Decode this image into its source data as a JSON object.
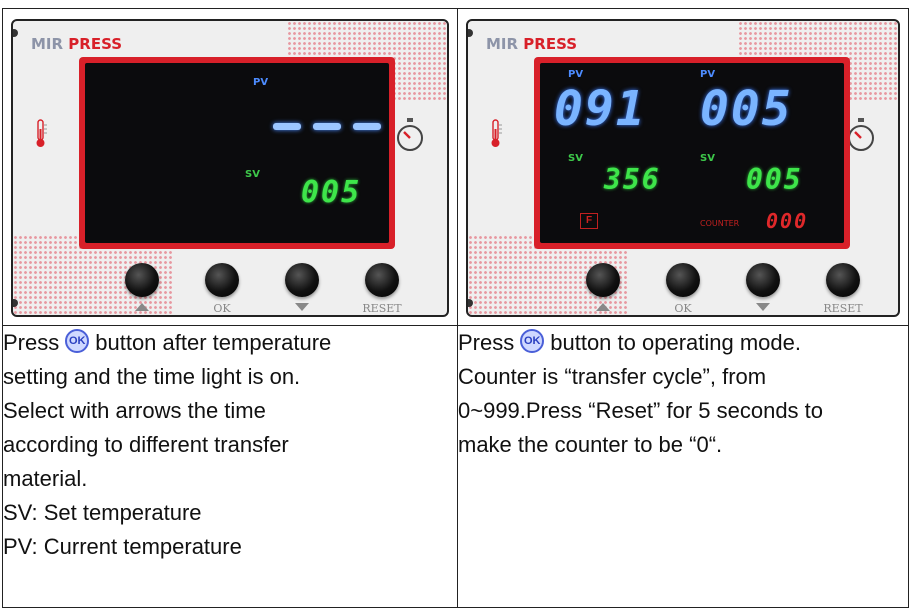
{
  "left_panel": {
    "brand_mir": "MIR",
    "brand_press": "PRESS",
    "pv_label": "PV",
    "sv_label": "SV",
    "sv_value": "005",
    "buttons": {
      "ok": "OK",
      "reset": "RESET"
    }
  },
  "right_panel": {
    "brand_mir": "MIR",
    "brand_press": "PRESS",
    "pv_label_1": "PV",
    "pv_label_2": "PV",
    "sv_label_1": "SV",
    "sv_label_2": "SV",
    "pv_temp": "091",
    "pv_time": "005",
    "sv_temp": "356",
    "sv_time": "005",
    "unit": "F",
    "counter_label": "COUNTER",
    "counter_value": "000",
    "buttons": {
      "ok": "OK",
      "reset": "RESET"
    }
  },
  "left_text": {
    "l1a": "Press",
    "ok_badge": "OK",
    "l1b": "button after temperature",
    "l2": "setting and the time light is on.",
    "l3": "Select with arrows the time",
    "l4": "according to different transfer",
    "l5": "material.",
    "l6": "SV: Set temperature",
    "l7": "PV: Current temperature"
  },
  "right_text": {
    "l1a": "Press",
    "ok_badge": "OK",
    "l1b": "button to operating mode.",
    "l2": "Counter is “transfer cycle”, from",
    "l3": "0~999.Press “Reset” for 5 seconds to",
    "l4": "make the counter to be “0“."
  },
  "colors": {
    "brand_red": "#d82029",
    "pv_blue": "#7ab4ff",
    "sv_green": "#3ee54a"
  }
}
